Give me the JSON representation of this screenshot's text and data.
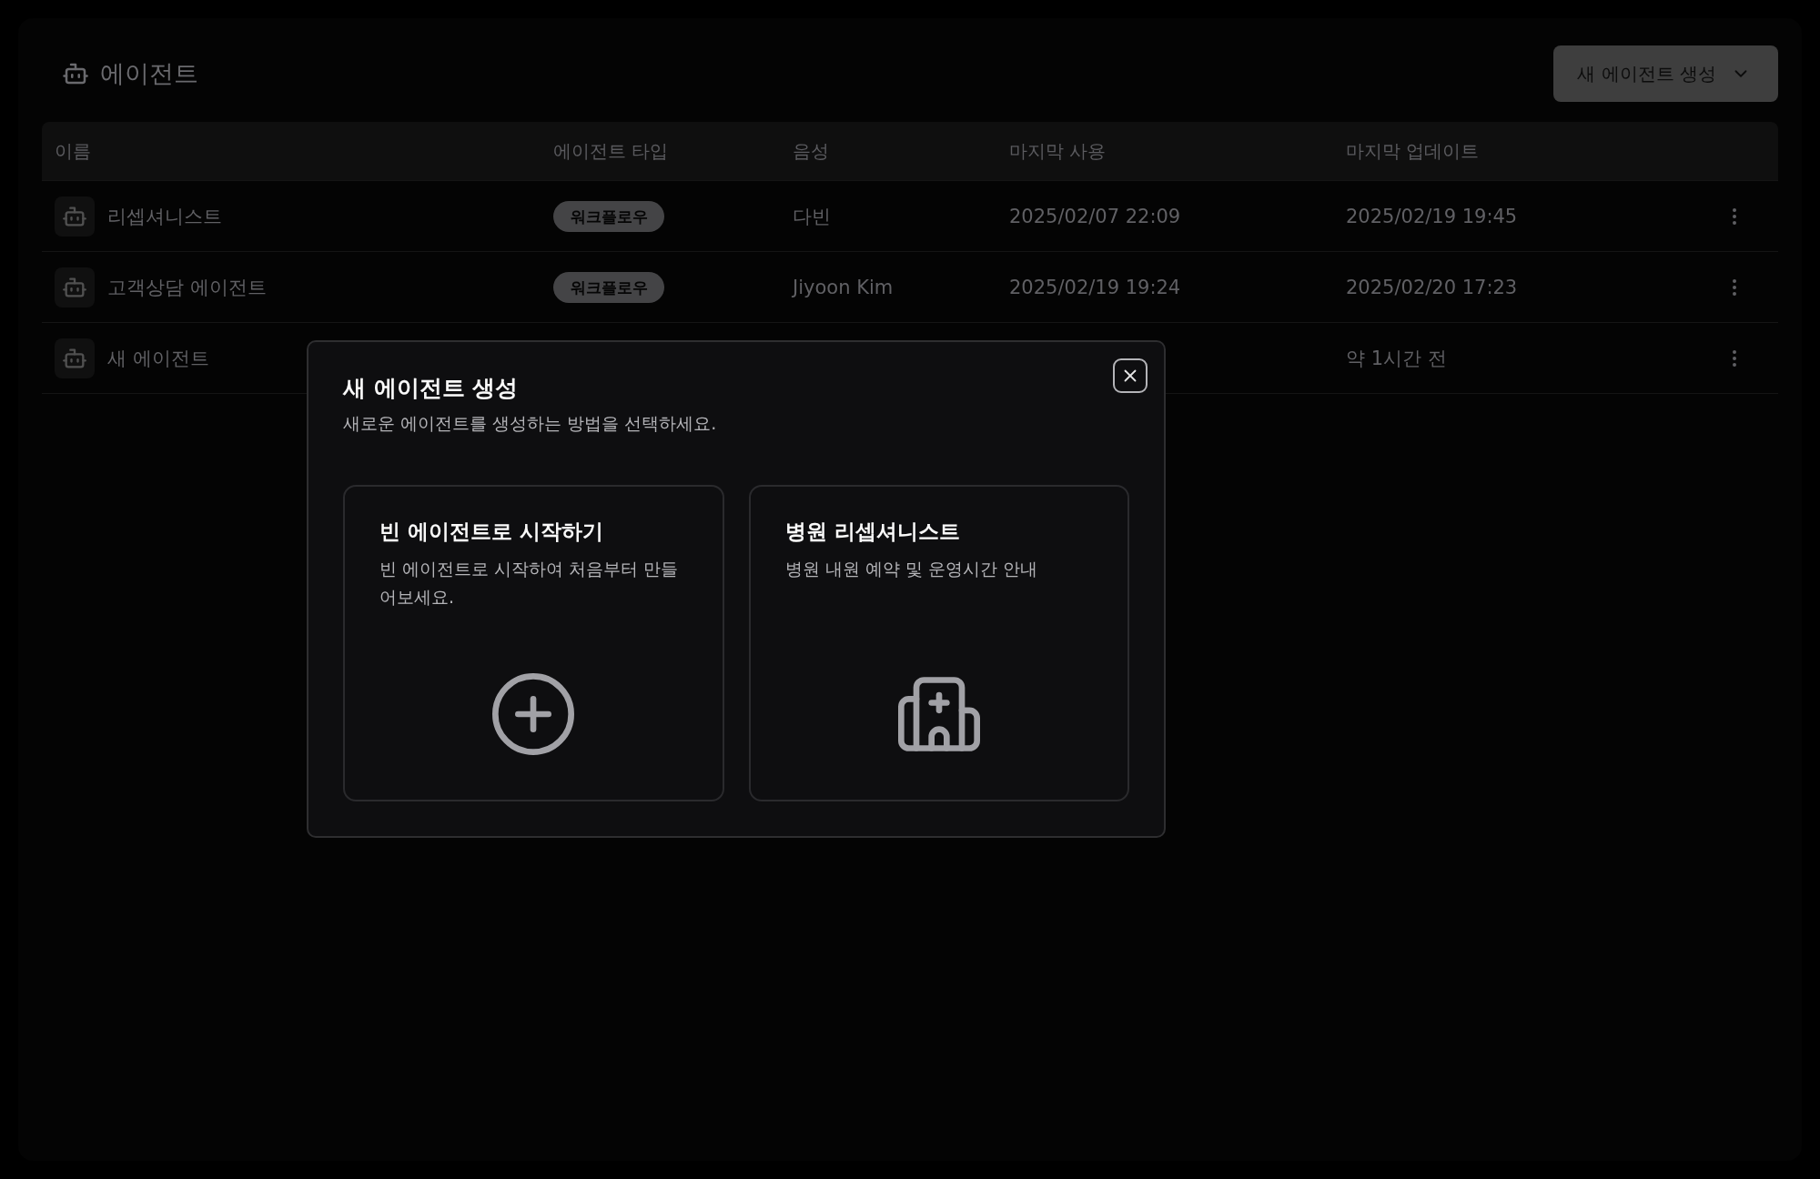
{
  "header": {
    "title": "에이전트",
    "create_button": "새 에이전트 생성"
  },
  "table": {
    "columns": [
      "이름",
      "에이전트 타입",
      "음성",
      "마지막 사용",
      "마지막 업데이트"
    ],
    "rows": [
      {
        "name": "리셉셔니스트",
        "type": "워크플로우",
        "voice": "다빈",
        "last_used": "2025/02/07 22:09",
        "last_updated": "2025/02/19 19:45"
      },
      {
        "name": "고객상담 에이전트",
        "type": "워크플로우",
        "voice": "Jiyoon Kim",
        "last_used": "2025/02/19 19:24",
        "last_updated": "2025/02/20 17:23"
      },
      {
        "name": "새 에이전트",
        "last_updated": "약 1시간 전"
      }
    ]
  },
  "dialog": {
    "title": "새 에이전트 생성",
    "subtitle": "새로운 에이전트를 생성하는 방법을 선택하세요.",
    "options": [
      {
        "kind": "blank",
        "title": "빈 에이전트로 시작하기",
        "description": "빈 에이전트로 시작하여 처음부터 만들어보세요."
      },
      {
        "kind": "hospital",
        "title": "병원 리셉셔니스트",
        "description": "병원 내원 예약 및 운영시간 안내"
      }
    ]
  }
}
